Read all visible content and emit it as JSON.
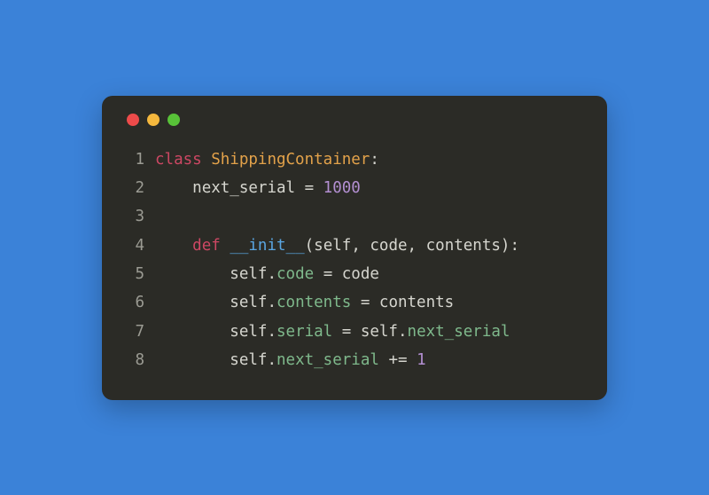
{
  "window": {
    "buttons": {
      "close": "close",
      "minimize": "minimize",
      "maximize": "maximize"
    }
  },
  "code": {
    "lines": [
      {
        "n": "1",
        "segs": [
          {
            "cls": "tok-kw",
            "t": "class"
          },
          {
            "cls": "tok-punct",
            "t": " "
          },
          {
            "cls": "tok-cls",
            "t": "ShippingContainer"
          },
          {
            "cls": "tok-punct",
            "t": ":"
          }
        ]
      },
      {
        "n": "2",
        "segs": [
          {
            "cls": "tok-punct",
            "t": "    "
          },
          {
            "cls": "tok-name",
            "t": "next_serial"
          },
          {
            "cls": "tok-punct",
            "t": " = "
          },
          {
            "cls": "tok-num",
            "t": "1000"
          }
        ]
      },
      {
        "n": "3",
        "segs": [
          {
            "cls": "tok-punct",
            "t": " "
          }
        ]
      },
      {
        "n": "4",
        "segs": [
          {
            "cls": "tok-punct",
            "t": "    "
          },
          {
            "cls": "tok-kw",
            "t": "def"
          },
          {
            "cls": "tok-punct",
            "t": " "
          },
          {
            "cls": "tok-fn",
            "t": "__init__"
          },
          {
            "cls": "tok-punct",
            "t": "("
          },
          {
            "cls": "tok-self",
            "t": "self"
          },
          {
            "cls": "tok-punct",
            "t": ", "
          },
          {
            "cls": "tok-param",
            "t": "code"
          },
          {
            "cls": "tok-punct",
            "t": ", "
          },
          {
            "cls": "tok-param",
            "t": "contents"
          },
          {
            "cls": "tok-punct",
            "t": "):"
          }
        ]
      },
      {
        "n": "5",
        "segs": [
          {
            "cls": "tok-punct",
            "t": "        "
          },
          {
            "cls": "tok-self",
            "t": "self"
          },
          {
            "cls": "tok-punct",
            "t": "."
          },
          {
            "cls": "tok-attr",
            "t": "code"
          },
          {
            "cls": "tok-punct",
            "t": " = code"
          }
        ]
      },
      {
        "n": "6",
        "segs": [
          {
            "cls": "tok-punct",
            "t": "        "
          },
          {
            "cls": "tok-self",
            "t": "self"
          },
          {
            "cls": "tok-punct",
            "t": "."
          },
          {
            "cls": "tok-attr",
            "t": "contents"
          },
          {
            "cls": "tok-punct",
            "t": " = contents"
          }
        ]
      },
      {
        "n": "7",
        "segs": [
          {
            "cls": "tok-punct",
            "t": "        "
          },
          {
            "cls": "tok-self",
            "t": "self"
          },
          {
            "cls": "tok-punct",
            "t": "."
          },
          {
            "cls": "tok-attr",
            "t": "serial"
          },
          {
            "cls": "tok-punct",
            "t": " = "
          },
          {
            "cls": "tok-self",
            "t": "self"
          },
          {
            "cls": "tok-punct",
            "t": "."
          },
          {
            "cls": "tok-attr",
            "t": "next_serial"
          }
        ]
      },
      {
        "n": "8",
        "segs": [
          {
            "cls": "tok-punct",
            "t": "        "
          },
          {
            "cls": "tok-self",
            "t": "self"
          },
          {
            "cls": "tok-punct",
            "t": "."
          },
          {
            "cls": "tok-attr",
            "t": "next_serial"
          },
          {
            "cls": "tok-punct",
            "t": " += "
          },
          {
            "cls": "tok-num",
            "t": "1"
          }
        ]
      }
    ]
  }
}
